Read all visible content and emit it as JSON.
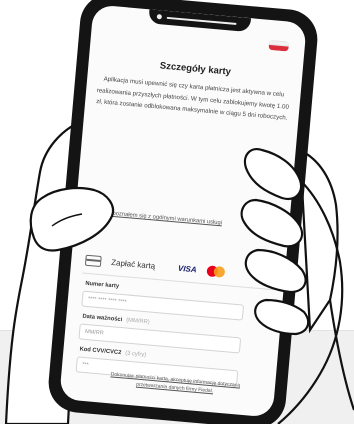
{
  "screen": {
    "title": "Szczegóły karty",
    "description": "Aplikacja musi upewnić się czy karta płatnicza jest aktywna w celu realizowania przyszłych płatności. W tym celu zablokujemy kwotę 1.00 zł, która zostanie odblokowana maksymalnie w ciągu 5 dni roboczych.",
    "consent": {
      "checked": true,
      "label": "*Zapoznałem się z ogólnymi warunkami usługi"
    },
    "payment_method": {
      "label": "Zapłać kartą",
      "brand_visa": "VISA",
      "card_icon": "credit-card-icon",
      "mastercard_icon": "mastercard-logo"
    },
    "fields": {
      "card_number": {
        "label": "Numer karty",
        "placeholder": "**** **** **** ****"
      },
      "expiry": {
        "label": "Data ważności",
        "hint": "(MM/RR)",
        "placeholder": "MM/RR"
      },
      "cvv": {
        "label": "Kod CVV/CVC2",
        "hint": "(3 cyfry)",
        "placeholder": "***"
      }
    },
    "footer": "Dokonując płatności kartą, akceptuję informację dotyczącą przetwarzania danych firmy Fiedal.",
    "colors": {
      "flag_red": "#dc2d3c",
      "visa_blue": "#1a1f71",
      "mc_red": "#eb001b",
      "mc_orange": "#f79e1b"
    }
  }
}
